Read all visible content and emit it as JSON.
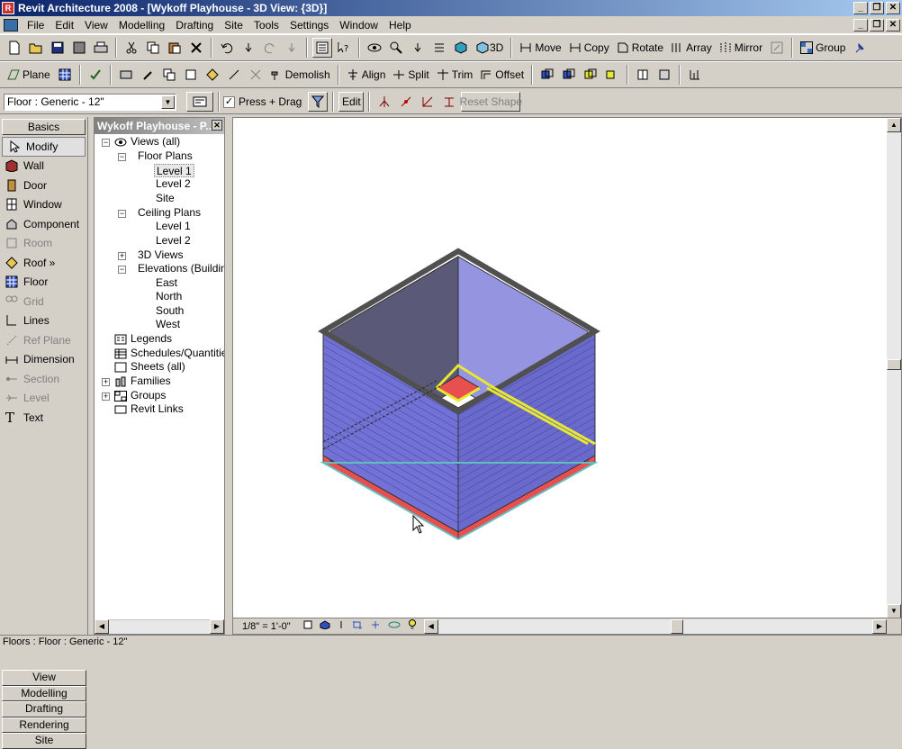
{
  "window": {
    "title": "Revit Architecture 2008 - [Wykoff Playhouse - 3D View: {3D}]",
    "minimize": "_",
    "restore": "❐",
    "close": "✕"
  },
  "menu": [
    "File",
    "Edit",
    "View",
    "Modelling",
    "Drafting",
    "Site",
    "Tools",
    "Settings",
    "Window",
    "Help"
  ],
  "toolbar1": {
    "d3": "3D",
    "move": "Move",
    "copy": "Copy",
    "rotate": "Rotate",
    "array": "Array",
    "mirror": "Mirror",
    "group": "Group"
  },
  "toolbar2": {
    "plane": "Plane",
    "demolish": "Demolish",
    "align": "Align",
    "split": "Split",
    "trim": "Trim",
    "offset": "Offset"
  },
  "options": {
    "type_selector": "Floor : Generic - 12\"",
    "press_drag": "Press + Drag",
    "edit": "Edit",
    "reset_shape": "Reset Shape"
  },
  "design_bar": {
    "header": "Basics",
    "items": [
      {
        "label": "Modify",
        "enabled": true
      },
      {
        "label": "Wall",
        "enabled": true
      },
      {
        "label": "Door",
        "enabled": true
      },
      {
        "label": "Window",
        "enabled": true
      },
      {
        "label": "Component",
        "enabled": true
      },
      {
        "label": "Room",
        "enabled": false
      },
      {
        "label": "Roof »",
        "enabled": true
      },
      {
        "label": "Floor",
        "enabled": true
      },
      {
        "label": "Grid",
        "enabled": false
      },
      {
        "label": "Lines",
        "enabled": true
      },
      {
        "label": "Ref Plane",
        "enabled": false
      },
      {
        "label": "Dimension",
        "enabled": true
      },
      {
        "label": "Section",
        "enabled": false
      },
      {
        "label": "Level",
        "enabled": false
      },
      {
        "label": "Text",
        "enabled": true
      }
    ],
    "tabs": [
      "View",
      "Modelling",
      "Drafting",
      "Rendering",
      "Site"
    ]
  },
  "project_browser": {
    "title": "Wykoff Playhouse - P...",
    "nodes": {
      "views": "Views (all)",
      "floor_plans": "Floor Plans",
      "fp_level1": "Level 1",
      "fp_level2": "Level 2",
      "fp_site": "Site",
      "ceiling_plans": "Ceiling Plans",
      "cp_level1": "Level 1",
      "cp_level2": "Level 2",
      "views3d": "3D Views",
      "elevations": "Elevations (Building",
      "east": "East",
      "north": "North",
      "south": "South",
      "west": "West",
      "legends": "Legends",
      "schedules": "Schedules/Quantitie",
      "sheets": "Sheets (all)",
      "families": "Families",
      "groups": "Groups",
      "links": "Revit Links"
    }
  },
  "view_controls": {
    "scale": "1/8\" = 1'-0\""
  },
  "colors": {
    "wall_face": "#7272d6",
    "wall_inner": "#8c8cde",
    "floor_red": "#e85050",
    "highlight": "#e8e830"
  },
  "status": "Floors : Floor : Generic - 12\""
}
